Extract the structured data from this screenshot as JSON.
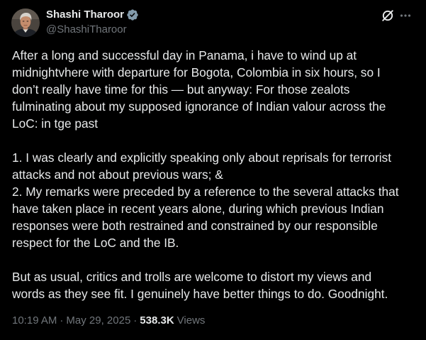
{
  "theme": {
    "background": "#000000",
    "text": "#e7e9ea",
    "muted": "#71767b",
    "badge": "#829aab"
  },
  "author": {
    "name": "Shashi Tharoor",
    "handle": "@ShashiTharoor",
    "avatar_icon": "avatar",
    "badge_icon": "verified-badge-icon"
  },
  "header_actions": {
    "grok_icon": "grok-icon",
    "more_icon": "more-icon"
  },
  "post": {
    "paragraphs": [
      [
        "After a long and successful day in Panama, i have to wind up at",
        "midnightvhere with departure for Bogota, Colombia in six hours, so I",
        "don’t really have time for this — but anyway: For those zealots",
        "fulminating about my supposed ignorance of Indian valour across the",
        "LoC: in tge past"
      ],
      [
        "1. I was clearly and explicitly speaking only about reprisals for terrorist",
        "attacks and not about previous wars; &",
        "2. My remarks were preceded by a reference to the several attacks that",
        "have taken place in recent years alone, during which previous Indian",
        "responses were both restrained and constrained by our responsible",
        "respect for the LoC and the IB."
      ],
      [
        "But as usual, critics and trolls are welcome to distort my views and",
        "words as they see fit. I genuinely have better things to do. Goodnight."
      ]
    ]
  },
  "meta": {
    "time": "10:19 AM",
    "separator": "·",
    "date": "May 29, 2025",
    "views_count": "538.3K",
    "views_label": "Views"
  }
}
